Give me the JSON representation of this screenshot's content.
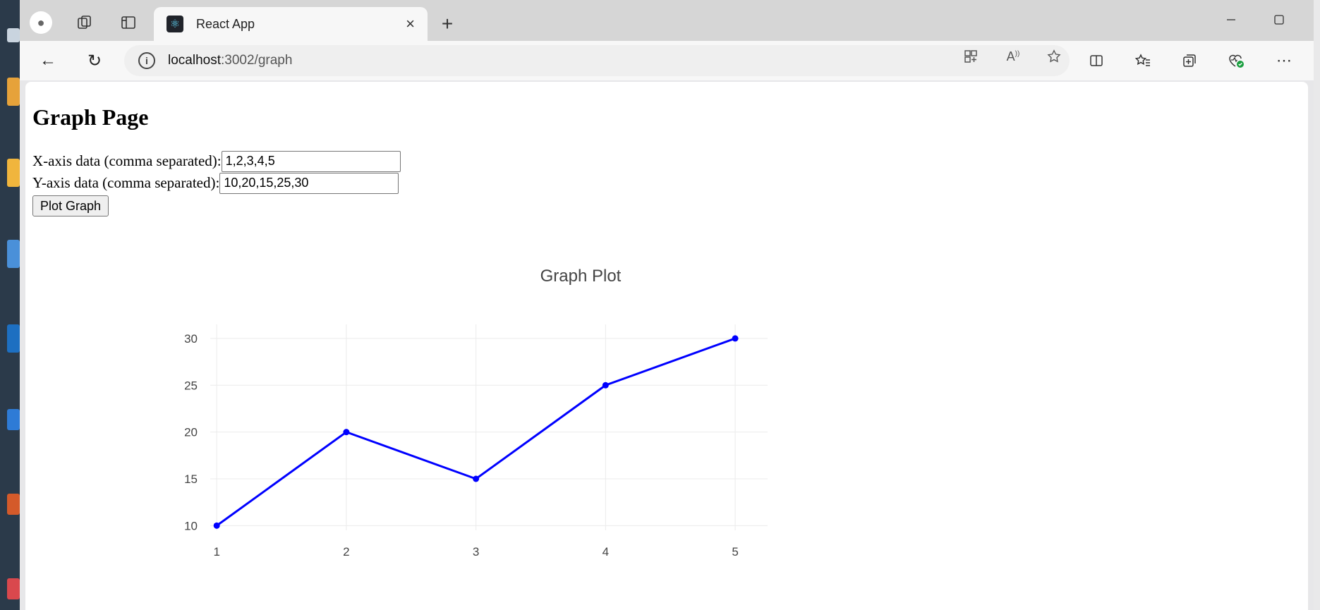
{
  "browser": {
    "tab_title": "React App",
    "url_host": "localhost",
    "url_path": ":3002/graph"
  },
  "page": {
    "heading": "Graph Page",
    "x_label": "X-axis data (comma separated):",
    "x_value": "1,2,3,4,5",
    "y_label": "Y-axis data (comma separated):",
    "y_value": "10,20,15,25,30",
    "plot_button": "Plot Graph"
  },
  "chart_data": {
    "type": "line",
    "title": "Graph Plot",
    "x": [
      1,
      2,
      3,
      4,
      5
    ],
    "y": [
      10,
      20,
      15,
      25,
      30
    ],
    "xticks": [
      1,
      2,
      3,
      4,
      5
    ],
    "yticks": [
      10,
      15,
      20,
      25,
      30
    ],
    "xlim": [
      0.95,
      5.25
    ],
    "ylim": [
      9.5,
      31.5
    ],
    "grid": true,
    "line_color": "#0000ff"
  },
  "icons": {
    "tab_close": "×",
    "new_tab": "+",
    "back": "←",
    "reload": "↻",
    "info": "i",
    "more": "⋯"
  }
}
